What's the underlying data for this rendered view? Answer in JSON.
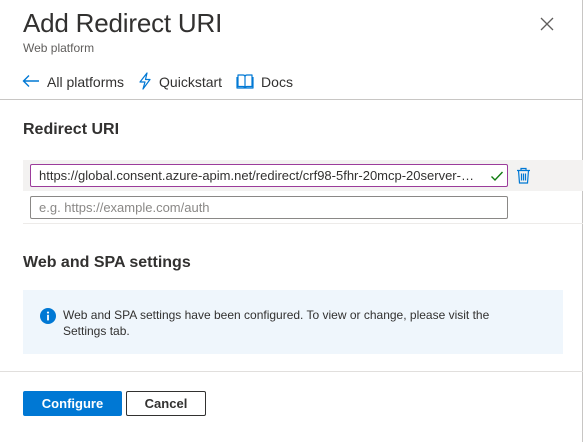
{
  "dialog": {
    "title": "Add Redirect URI",
    "subtitle": "Web platform"
  },
  "commands": {
    "all_platforms": "All platforms",
    "quickstart": "Quickstart",
    "docs": "Docs"
  },
  "redirect": {
    "heading": "Redirect URI",
    "uris": [
      "https://global.consent.azure-apim.net/redirect/crf98-5fhr-20mcp-20server-20..."
    ],
    "new_placeholder": "e.g. https://example.com/auth",
    "new_value": ""
  },
  "spa": {
    "heading": "Web and SPA settings",
    "info": "Web and SPA settings have been configured. To view or change, please visit the Settings tab."
  },
  "footer": {
    "configure_label": "Configure",
    "cancel_label": "Cancel"
  },
  "colors": {
    "accent": "#0078d4",
    "info_background": "#eff6fc",
    "valid_check": "#107c10"
  },
  "icons": {
    "close": "close-icon",
    "back": "arrow-left-icon",
    "quickstart": "lightning-icon",
    "docs": "book-icon",
    "valid": "checkmark-icon",
    "delete": "trash-icon",
    "info": "info-icon"
  }
}
